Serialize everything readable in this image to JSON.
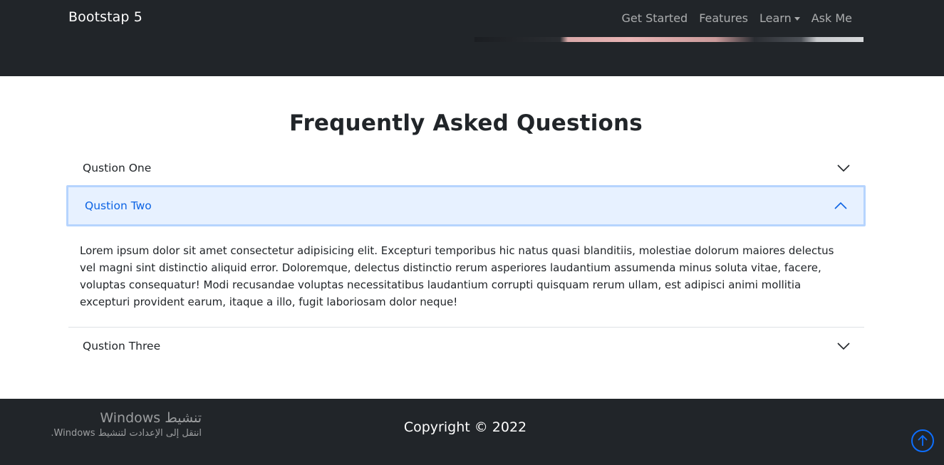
{
  "navbar": {
    "brand": "Bootstap 5",
    "items": [
      {
        "label": "Get Started"
      },
      {
        "label": "Features"
      },
      {
        "label": "Learn"
      },
      {
        "label": "Ask Me"
      }
    ]
  },
  "faq": {
    "title": "Frequently Asked Questions",
    "questions": [
      {
        "label": "Qustion One",
        "expanded": false
      },
      {
        "label": "Qustion Two",
        "expanded": true,
        "body": "Lorem ipsum dolor sit amet consectetur adipisicing elit. Excepturi temporibus hic natus quasi blanditiis, molestiae dolorum maiores delectus vel magni sint distinctio aliquid error. Doloremque, delectus distinctio rerum asperiores laudantium assumenda minus soluta vitae, facere, voluptas consequatur! Modi recusandae voluptas necessitatibus laudantium corrupti quisquam rerum ullam, est adipisci animi mollitia excepturi provident earum, itaque a illo, fugit laboriosam dolor neque!"
      },
      {
        "label": "Qustion Three",
        "expanded": false
      }
    ]
  },
  "footer": {
    "copyright": "Copyright © 2022",
    "windows_watermark": {
      "line1": "تنشيط Windows",
      "line2": "انتقل إلى الإعدادت لتنشيط Windows."
    }
  },
  "icons": {
    "dropdown": "caret-down-icon",
    "collapsed": "chevron-down-icon",
    "expanded": "chevron-up-icon",
    "back_to_top": "arrow-up-circle-icon"
  },
  "colors": {
    "dark": "#212529",
    "accent": "#0d6efd",
    "active_bg": "#e7f1ff",
    "active_text": "#0c63e4"
  }
}
